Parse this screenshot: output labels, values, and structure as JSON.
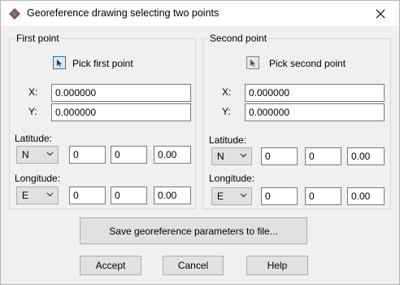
{
  "window": {
    "title": "Georeference drawing selecting two points"
  },
  "first_point": {
    "group_label": "First point",
    "pick_label": "Pick first point",
    "x_label": "X:",
    "x_value": "0.000000",
    "y_label": "Y:",
    "y_value": "0.000000",
    "latitude_label": "Latitude:",
    "lat_hemisphere": "N",
    "lat_deg": "0",
    "lat_min": "0",
    "lat_sec": "0.00",
    "longitude_label": "Longitude:",
    "lon_hemisphere": "E",
    "lon_deg": "0",
    "lon_min": "0",
    "lon_sec": "0.00"
  },
  "second_point": {
    "group_label": "Second point",
    "pick_label": "Pick second point",
    "x_label": "X:",
    "x_value": "0.000000",
    "y_label": "Y:",
    "y_value": "0.000000",
    "latitude_label": "Latitude:",
    "lat_hemisphere": "N",
    "lat_deg": "0",
    "lat_min": "0",
    "lat_sec": "0.00",
    "longitude_label": "Longitude:",
    "lon_hemisphere": "E",
    "lon_deg": "0",
    "lon_min": "0",
    "lon_sec": "0.00"
  },
  "buttons": {
    "save": "Save georeference parameters to file...",
    "accept": "Accept",
    "cancel": "Cancel",
    "help": "Help"
  },
  "icons": {
    "app": "georeference-app-icon",
    "close": "close-icon",
    "pick": "pick-point-icon"
  }
}
